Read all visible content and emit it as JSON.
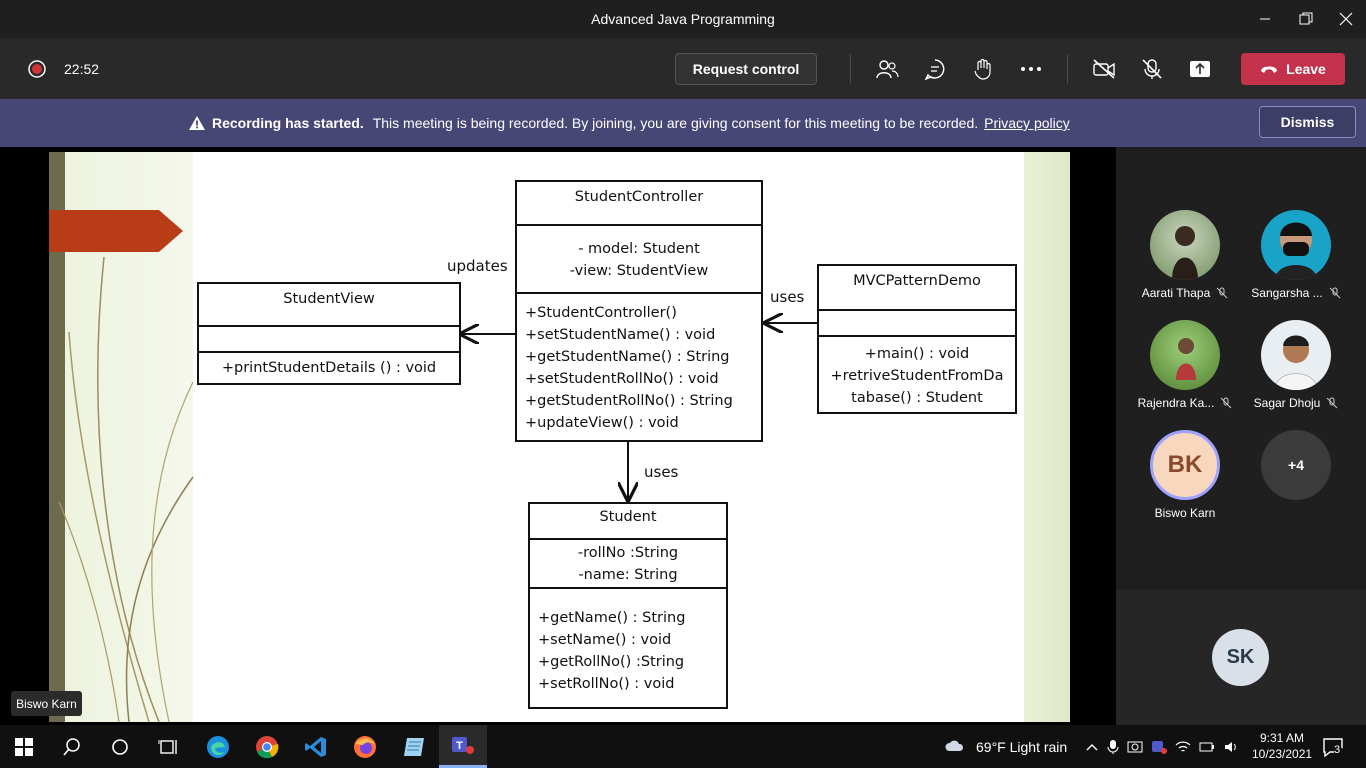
{
  "window": {
    "title": "Advanced Java Programming"
  },
  "toolbar": {
    "timer": "22:52",
    "request_control": "Request control",
    "leave": "Leave"
  },
  "banner": {
    "bold": "Recording has started.",
    "message": "This meeting is being recorded. By joining, you are giving consent for this meeting to be recorded.",
    "link": "Privacy policy",
    "dismiss": "Dismiss"
  },
  "slide": {
    "controller": {
      "name": "StudentController",
      "attrs": [
        "- model: Student",
        "-view: StudentView"
      ],
      "methods": [
        "+StudentController()",
        "+setStudentName()  : void",
        "+getStudentName()  : String",
        "+setStudentRollNo()  : void",
        "+getStudentRollNo()  : String",
        "+updateView()  : void"
      ]
    },
    "view": {
      "name": "StudentView",
      "methods": [
        "+printStudentDetails  () : void"
      ]
    },
    "demo": {
      "name": "MVCPatternDemo",
      "methods": [
        "+main()  : void",
        "+retriveStudentFromDa",
        "tabase() : Student"
      ]
    },
    "student": {
      "name": "Student",
      "attrs": [
        "-rollNo  :String",
        "-name:  String"
      ],
      "methods": [
        "+getName()  : String",
        "+setName()  : void",
        "+getRollNo()  :String",
        "+setRollNo()  : void"
      ]
    },
    "labels": {
      "updates": "updates",
      "uses_demo": "uses",
      "uses_student": "uses"
    }
  },
  "presenter_tag": "Biswo Karn",
  "participants": [
    {
      "name": "Aarati Thapa"
    },
    {
      "name": "Sangarsha ..."
    },
    {
      "name": "Rajendra Ka..."
    },
    {
      "name": "Sagar Dhoju"
    },
    {
      "name": "Biswo Karn",
      "initials": "BK"
    },
    {
      "more": "+4"
    }
  ],
  "self_initials": "SK",
  "taskbar": {
    "weather": "69°F  Light rain",
    "time": "9:31 AM",
    "date": "10/23/2021",
    "notifications": "3"
  },
  "colors": {
    "leave": "#c4314b",
    "banner": "#464775",
    "ribbon": "#b83d17"
  }
}
